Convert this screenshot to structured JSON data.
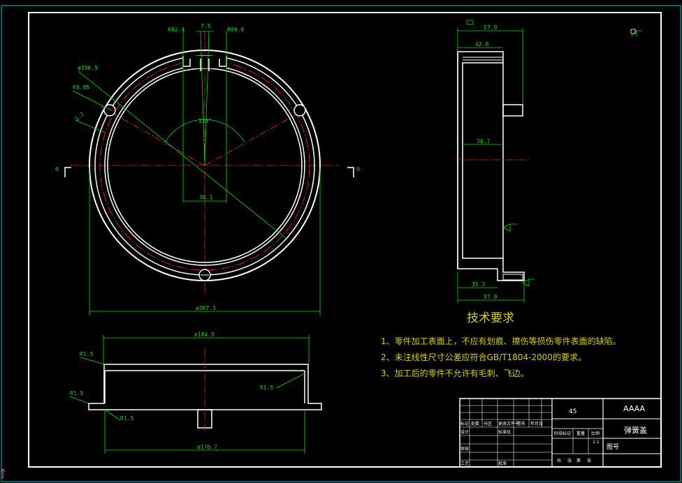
{
  "drawing": {
    "dims_top": {
      "r1": "R92.4",
      "w": "7.5",
      "r2": "R99.9",
      "phi196": "ø196.5",
      "r585": "R5.85",
      "l2": "1.2",
      "angle": "120°",
      "d381": "38.1",
      "phi207": "ø207.3"
    },
    "dims_side": {
      "w579_top": "57.9",
      "w426": "42.6",
      "w387": "38.7",
      "w351": "35.1",
      "w579_bottom": "57.9"
    },
    "dims_section": {
      "phi1845": "ø184.5",
      "r15_a": "R1.5",
      "r15_b": "R1.5",
      "r15_c": "R1.5",
      "r15_d": "R1.5",
      "phi1767": "ø176.7"
    },
    "tech_title": "技术要求",
    "tech_notes": [
      "1、零件加工表面上，不应有划痕、擦伤等损伤零件表面的缺陷。",
      "2、未注线性尺寸公差应符合GB/T1804-2000的要求。",
      "3、加工后的零件不允许有毛刺、飞边。"
    ],
    "title_block": {
      "material": "45",
      "code": "AAAA",
      "part_name": "弹簧盖",
      "drawing_no_label": "图号",
      "scale": "1:1",
      "row1": [
        "标记",
        "处数",
        "分区",
        "更改文件号",
        "签名",
        "年月日"
      ],
      "row2": [
        "设计",
        "标准化"
      ],
      "row3": [
        "审核"
      ],
      "row4": [
        "工艺",
        "批准"
      ],
      "stage_labels": [
        "阶段标记",
        "重量",
        "比例"
      ],
      "sheet": [
        "共",
        "张",
        "第",
        "张"
      ]
    }
  },
  "colors": {
    "background": "#000000",
    "outline": "#ffffff",
    "center_line": "#ff2020",
    "dimension": "#00e000",
    "text_note": "#d8d000",
    "frame_cyan": "#00c8c8"
  }
}
